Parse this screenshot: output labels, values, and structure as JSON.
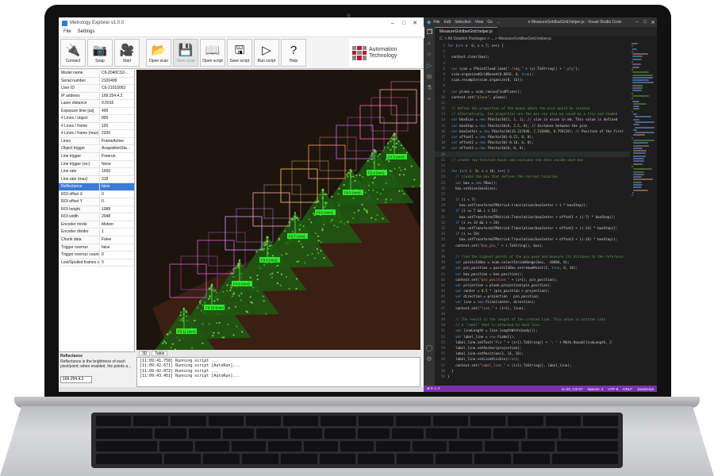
{
  "explorer": {
    "title": "Metrology Explorer v1.0.0",
    "menu": [
      "File",
      "Settings"
    ],
    "toolbar": [
      {
        "label": "Connect",
        "icon": "plug-icon",
        "glyph": "🔌",
        "disabled": false
      },
      {
        "label": "Snap",
        "icon": "camera-icon",
        "glyph": "📷",
        "disabled": false
      },
      {
        "label": "Start",
        "icon": "video-camera-icon",
        "glyph": "🎥",
        "disabled": false
      },
      {
        "label": "Open scan",
        "icon": "folder-icon",
        "glyph": "📂",
        "disabled": false
      },
      {
        "label": "Save scan",
        "icon": "save-icon",
        "glyph": "💾",
        "disabled": true
      },
      {
        "label": "Open script",
        "icon": "book-icon",
        "glyph": "📖",
        "disabled": false
      },
      {
        "label": "Save script",
        "icon": "save-script-icon",
        "glyph": "🖫",
        "disabled": false
      },
      {
        "label": "Run script",
        "icon": "play-icon",
        "glyph": "▷",
        "disabled": false
      },
      {
        "label": "Help",
        "icon": "help-icon",
        "glyph": "?",
        "disabled": false
      }
    ],
    "logo": {
      "line1": "Automation",
      "line2": "Technology",
      "accent": "#c8102e"
    },
    "properties": [
      {
        "name": "Model name",
        "value": "C6-2040CS2-..."
      },
      {
        "name": "Serial number",
        "value": "2100409"
      },
      {
        "name": "User ID",
        "value": "C6-21010062"
      },
      {
        "name": "IP address",
        "value": "169.254.4.2"
      },
      {
        "name": "Laser distance",
        "value": "0.0016"
      },
      {
        "name": "Exposure time [us]",
        "value": "400"
      },
      {
        "name": "# Lines / object",
        "value": "800"
      },
      {
        "name": "# Lines / frame",
        "value": "100"
      },
      {
        "name": "# Lines / frame (max)",
        "value": "2200"
      },
      {
        "name": "Lines",
        "value": "FrameActive"
      },
      {
        "name": "Object trigger",
        "value": "AcquisitionSta..."
      },
      {
        "name": "Line trigger",
        "value": "Freerun"
      },
      {
        "name": "Line trigger (src)",
        "value": "None"
      },
      {
        "name": "Line rate",
        "value": "1000"
      },
      {
        "name": "Line rate (max)",
        "value": "318"
      },
      {
        "name": "Reflectance",
        "value": "false",
        "selected": true
      },
      {
        "name": "ROI offset X",
        "value": "0"
      },
      {
        "name": "ROI offset Y",
        "value": "0"
      },
      {
        "name": "ROI height",
        "value": "1088"
      },
      {
        "name": "ROI width",
        "value": "2048"
      },
      {
        "name": "Encoder mode",
        "value": "Motion"
      },
      {
        "name": "Encoder divider",
        "value": "1"
      },
      {
        "name": "Chunk data",
        "value": "False"
      },
      {
        "name": "Trigger overrun",
        "value": "false"
      },
      {
        "name": "Trigger overrun count",
        "value": "0"
      },
      {
        "name": "Lost/Spoiled frames count",
        "value": "0"
      }
    ],
    "description": {
      "title": "Reflectance",
      "text": "Reflectance is the brightness of each pixel/point; when enabled, the points a..."
    },
    "ip_field": "169.254.4.2",
    "viewer_tabs": [
      "3D",
      "Table"
    ],
    "log": [
      "[11:09:41.758] Running script ...",
      "[11:09:42.671] Running script [AutoRun]...",
      "[11:09:42.872] Running script ...",
      "[11:09:43.451] Running script [AutoRun]..."
    ],
    "measure_labels": [
      "Fit 11 (mm)",
      "Fit 10 (mm)",
      "Fit 9 (mm)",
      "Fit 8 (mm)",
      "Fit 7 (mm)",
      "Fit 6 (mm)",
      "Fit 5 (mm)",
      "Fit 4 (mm)",
      "Fit 3 (mm)"
    ]
  },
  "vscode": {
    "title": "e MeasureGoldbarGrid.helper.js - Visual Studio Code",
    "menu": [
      "File",
      "Edit",
      "Selection",
      "View",
      "Go",
      "..."
    ],
    "tab": "MeasureGoldbarGrid.helper.js",
    "breadcrumb": "C: > All Solution Packages > ... > MeasureGoldbarGrid.helper.js",
    "activity_icons": [
      "files-icon",
      "search-icon",
      "source-control-icon",
      "debug-icon",
      "extensions-icon",
      "test-icon",
      "remote-icon",
      "account-icon",
      "settings-icon"
    ],
    "code_lines": [
      "for (int x  0; x < 7; x++) {",
      "",
      "  context.clear(box);",
      "",
      "  var scan = FPointCloud.load(\"./img_\" + (x).ToString() + \".ply\");",
      "  scan.organizedGridBased(0.0016, 0, true);",
      "  scan.resample(scan.organize(0, 16));",
      "",
      "  var plane = scan.ransacFindPlane();",
      "  context.set(\"plane\", plane);",
      "",
      "  // define the properties of the boxes where the pins would be located",
      "  // alternatively, the properties are the box can also be saved as a file and loaded",
      "  var boxSize = new FVector3d(1, 1, 1); // size in vscan in mm. This value is defined",
      "  var boxStep = new FVector3d(0, 2.5, 0); // distance between the pins",
      "  var boxCenter = new FVector3d(26.237040, 2.516900, 0.799220); // Position of the first",
      "  var offset1 = new FVector3d(-0.21, 0, 0);",
      "  var offset2 = new FVector3d(-0.18, 0, 0);",
      "  var offset3 = new FVector3d(0, 0, 0);",
      "",
      "  // create ray-tolerant boxes and evaluate the data inside each box",
      "",
      "  for (int i  0; i < 10; i++) {",
      "    // create the box that defines the current location",
      "    var box = new FBox();",
      "    box.setSize(boxSize);",
      "",
      "    if (i < 7)",
      "      box.setTransform(FMatrix4.translation(boxCenter + i * boxStep));",
      "    if (i >= 7 && i < 14)",
      "      box.setTransform(FMatrix4.Translation(boxCenter + offset1 + (i-7) * boxStep));",
      "    if (i >= 14 && i < 20)",
      "      box.setTransform(FMatrix4.Translation(boxCenter + offset2 + (i-14) * boxStep));",
      "    if (i >= 20)",
      "      box.setTransform(FMatrix4.Translation(boxCenter + offset3 + (i-20) * boxStep));",
      "    context.set(\"box_pin_\" + i.ToString(), box);",
      "",
      "    // find the highest points of the pin peak and measure its distance to the reference",
      "    var pointsInBox = scan.selectInsideRange(box, -10000, 0);",
      "    var pin_position = pointsInBox.extremumPoint(2, true, 0, 30);",
      "    var box_position = box.position();",
      "    context.set(\"pin_position_\" + (i+1), pin_position);",
      "    var projection = plane.projection(pin_position);",
      "    var center = 0.5 * (pin_position + projection);",
      "    var direction = projection - pin_position;",
      "    var line = new FLine(center, direction);",
      "    context.set(\"line_\" + (i+1), line);",
      "",
      "    // The result is the length of the created line. This value is written into",
      "    // a 'label' that is attached to each line.",
      "    var lineLength = line.lengthWith(body());",
      "    var label_line = new FLabel();",
      "    label_line.setText(\"Pin \" + (i+1).ToString() + \": \" + Math.Round(lineLength, 2",
      "    label_line.setAnchor(projection);",
      "    label_line.setPosition(3, 14, 20);",
      "    label_line.setLineVisible(true);",
      "    context.set(\"label_line_\" + (i+1).ToString(), label_line);",
      "  }",
      "}"
    ],
    "first_line_number": 1,
    "highlighted_line": 20,
    "status": {
      "left": "⊗ 0 ⚠ 0",
      "items": [
        "Ln 20, Col 57",
        "Spaces: 4",
        "UTF-8",
        "CRLF",
        "JavaScript"
      ]
    },
    "status_color": "#7b2fb0"
  }
}
